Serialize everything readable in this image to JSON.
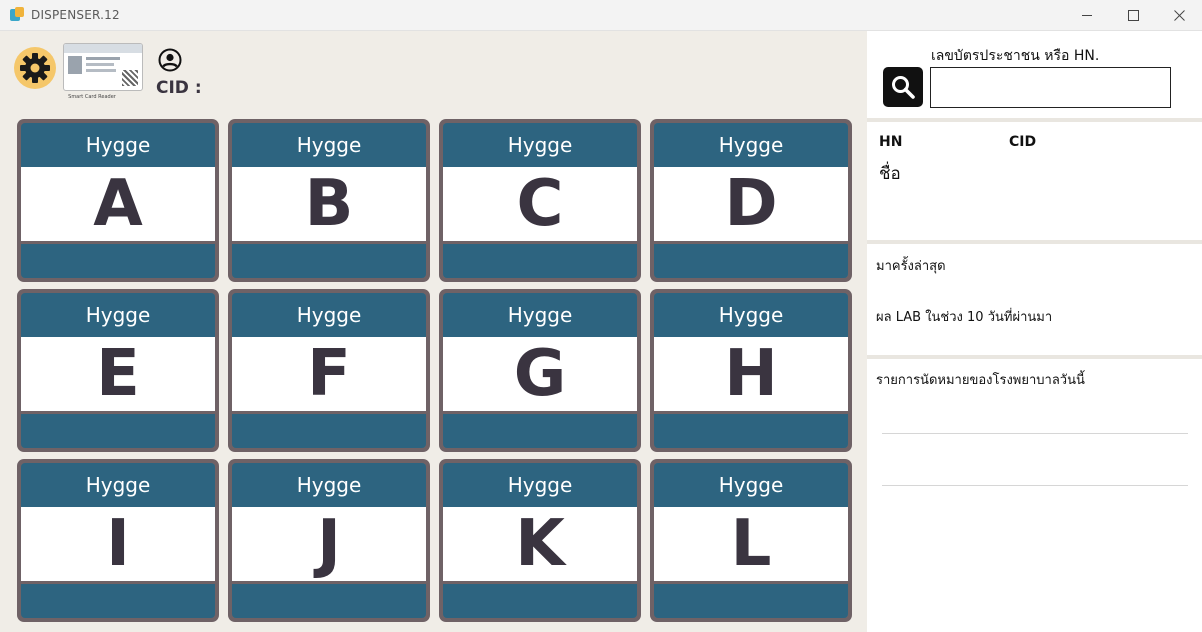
{
  "window": {
    "title": "DISPENSER.12"
  },
  "header": {
    "reader_caption": "Smart Card Reader",
    "cid_label": "CID :"
  },
  "dispensers": [
    {
      "brand": "Hygge",
      "letter": "A"
    },
    {
      "brand": "Hygge",
      "letter": "B"
    },
    {
      "brand": "Hygge",
      "letter": "C"
    },
    {
      "brand": "Hygge",
      "letter": "D"
    },
    {
      "brand": "Hygge",
      "letter": "E"
    },
    {
      "brand": "Hygge",
      "letter": "F"
    },
    {
      "brand": "Hygge",
      "letter": "G"
    },
    {
      "brand": "Hygge",
      "letter": "H"
    },
    {
      "brand": "Hygge",
      "letter": "I"
    },
    {
      "brand": "Hygge",
      "letter": "J"
    },
    {
      "brand": "Hygge",
      "letter": "K"
    },
    {
      "brand": "Hygge",
      "letter": "L"
    }
  ],
  "search": {
    "caption": "เลขบัตรประชาชน หรือ HN.",
    "value": ""
  },
  "patient": {
    "hn_label": "HN",
    "cid_label": "CID",
    "name_label": "ชื่อ"
  },
  "history": {
    "last_visit_label": "มาครั้งล่าสุด",
    "lab_label": "ผล LAB ในช่วง 10 วันที่ผ่านมา"
  },
  "appointments": {
    "label": "รายการนัดหมายของโรงพยาบาลวันนี้"
  },
  "colors": {
    "tile_header": "#2d6480",
    "tile_border": "#6f6266",
    "letter": "#3a3440",
    "gear_bg": "#f5c76a",
    "search_button": "#111111"
  },
  "icons": {
    "settings": "gear-icon",
    "user": "user-circle-icon",
    "search": "search-icon",
    "minimize": "minimize-icon",
    "maximize": "maximize-icon",
    "close": "close-icon"
  }
}
